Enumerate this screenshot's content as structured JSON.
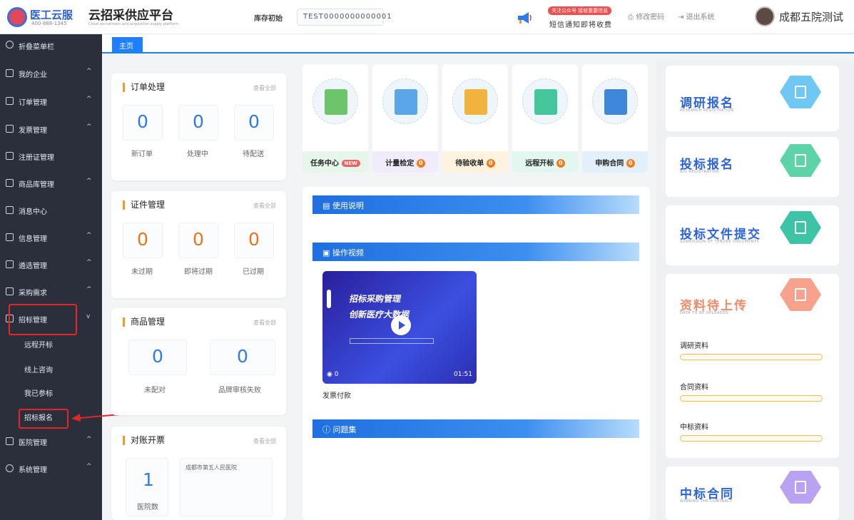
{
  "header": {
    "logo_name": "医工云服",
    "logo_tel": "400-888-1345",
    "platform_title": "云招采供应平台",
    "platform_subtitle": "Cloud recruitment and acquisition supply platform",
    "library_label": "库存初始",
    "library_value": "TEST0000000000001",
    "notice_tag": "关注公众号 接收重要信息",
    "notice_text": "短信通知即将收费",
    "change_password": "修改密码",
    "logout": "退出系统",
    "user_name": "成都五院测试"
  },
  "sidebar": {
    "collapse": "折叠菜单栏",
    "items": [
      {
        "label": "我的企业",
        "arrow": "^"
      },
      {
        "label": "订单管理",
        "arrow": "^"
      },
      {
        "label": "发票管理",
        "arrow": "^"
      },
      {
        "label": "注册证管理",
        "arrow": ""
      },
      {
        "label": "商品库管理",
        "arrow": "^"
      },
      {
        "label": "消息中心",
        "arrow": ""
      },
      {
        "label": "信息管理",
        "arrow": "^"
      },
      {
        "label": "遴选管理",
        "arrow": "^"
      },
      {
        "label": "采购需求",
        "arrow": "^"
      },
      {
        "label": "招标管理",
        "arrow": "v"
      },
      {
        "label": "医院管理",
        "arrow": "^"
      },
      {
        "label": "系统管理",
        "arrow": "^"
      }
    ],
    "sub_items": [
      "远程开标",
      "线上咨询",
      "我已参标",
      "招标报名"
    ]
  },
  "tabs": {
    "home": "主页"
  },
  "order": {
    "title": "订单处理",
    "more": "查看全部",
    "values": [
      "0",
      "0",
      "0"
    ],
    "labels": [
      "新订单",
      "处理中",
      "待配送"
    ]
  },
  "cert": {
    "title": "证件管理",
    "more": "查看全部",
    "values": [
      "0",
      "0",
      "0"
    ],
    "labels": [
      "未过期",
      "即将过期",
      "已过期"
    ]
  },
  "goods": {
    "title": "商品管理",
    "more": "查看全部",
    "values": [
      "0",
      "0"
    ],
    "labels": [
      "未配对",
      "品牌审核失败"
    ]
  },
  "reconcile": {
    "title": "对账开票",
    "more": "查看全部",
    "value": "1",
    "label": "医院数",
    "hospital": "成都市第五人民医院"
  },
  "tiles": [
    {
      "label": "任务中心",
      "badge": "NEW"
    },
    {
      "label": "计量检定",
      "badge": "0"
    },
    {
      "label": "待验收单",
      "badge": "0"
    },
    {
      "label": "远程开标",
      "badge": "0"
    },
    {
      "label": "申购合同",
      "badge": "0"
    }
  ],
  "guide": {
    "manual": "使用说明",
    "video_section": "操作视频",
    "video_title": "发票付款",
    "video_views": "0",
    "video_duration": "01:51",
    "faq": "问题集",
    "video_banner_1": "招标采购管理",
    "video_banner_2": "创新医疗大数据"
  },
  "right": {
    "research": {
      "title": "调研报名",
      "sub": "RESEARCH REGISTRATION",
      "color": "#6fc7f3"
    },
    "bid": {
      "title": "投标报名",
      "sub": "BID REGISTRATION",
      "color": "#5fd3a8"
    },
    "submit": {
      "title": "投标文件提交",
      "sub": "SUBMISSION OF TENDER DOCUMENTS",
      "color": "#3dc4a6"
    },
    "upload": {
      "title": "资料待上传",
      "sub": "DATA TO BE UPLOADED",
      "items": [
        "调研资料",
        "合同资料",
        "中标资料"
      ],
      "color": "#f6a28c"
    },
    "contract": {
      "title": "中标合同",
      "sub": "WINNING THE CONTRACT",
      "color": "#b9a2f2"
    }
  },
  "colors": {
    "primary": "#1e80ff",
    "sidebar": "#2a2f3b",
    "accent_orange": "#f19a2a",
    "highlight": "#e02828"
  }
}
